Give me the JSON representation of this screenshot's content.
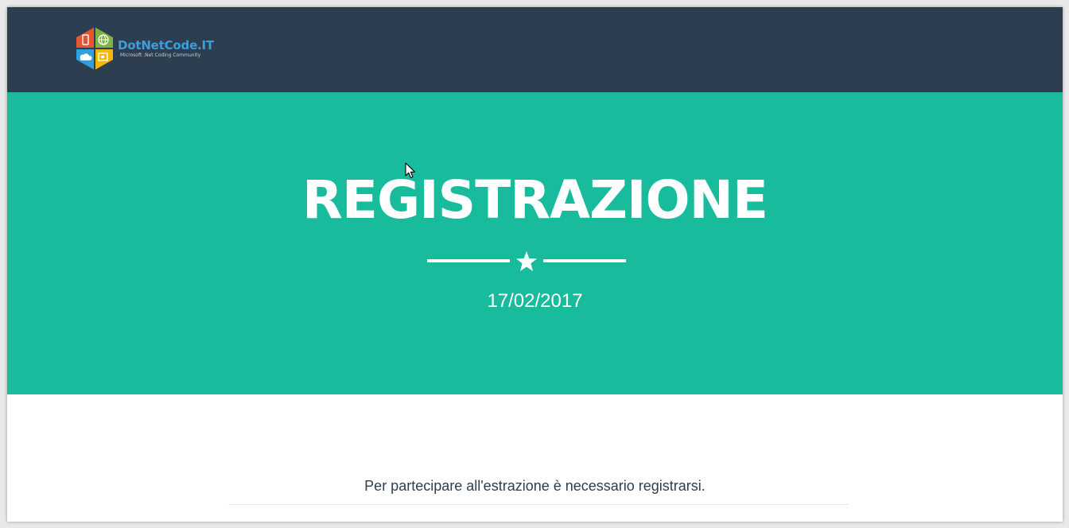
{
  "brand": {
    "name": "DotNetCode.IT",
    "tagline": "Microsoft .Net Coding Community",
    "logo_icon": "hexagon-logo-icon"
  },
  "hero": {
    "title": "REGISTRAZIONE",
    "divider_icon": "star-icon",
    "date": "17/02/2017"
  },
  "content": {
    "notice": "Per partecipare all'estrazione è necessario registrarsi."
  },
  "colors": {
    "navbar": "#2c3e50",
    "hero": "#18bc9c",
    "brand_text": "#3a9fdc",
    "body_text": "#2c3e50"
  }
}
